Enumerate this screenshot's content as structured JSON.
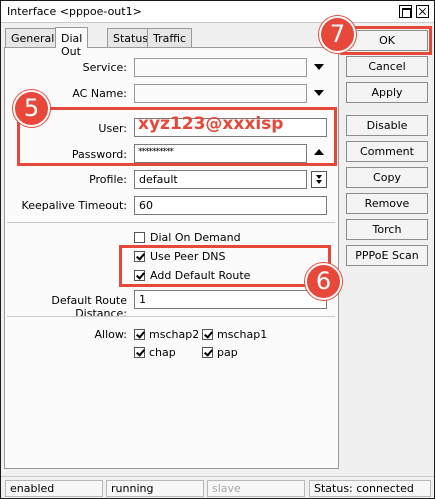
{
  "window": {
    "title": "Interface <pppoe-out1>"
  },
  "tabs": [
    "General",
    "Dial Out",
    "Status",
    "Traffic"
  ],
  "form": {
    "service_label": "Service:",
    "service_value": "",
    "ac_name_label": "AC Name:",
    "ac_name_value": "",
    "user_label": "User:",
    "user_value": "xyz123@xxxisp",
    "password_label": "Password:",
    "password_value": "**********",
    "profile_label": "Profile:",
    "profile_value": "default",
    "keepalive_label": "Keepalive Timeout:",
    "keepalive_value": "60",
    "dial_on_demand_label": "Dial On Demand",
    "dial_on_demand_checked": false,
    "use_peer_dns_label": "Use Peer DNS",
    "use_peer_dns_checked": true,
    "add_default_route_label": "Add Default Route",
    "add_default_route_checked": true,
    "default_route_distance_label": "Default Route Distance:",
    "default_route_distance_value": "1",
    "allow_label": "Allow:",
    "allow_options": [
      {
        "label": "mschap2",
        "checked": true
      },
      {
        "label": "mschap1",
        "checked": true
      },
      {
        "label": "chap",
        "checked": true
      },
      {
        "label": "pap",
        "checked": true
      }
    ]
  },
  "buttons": {
    "ok": "OK",
    "cancel": "Cancel",
    "apply": "Apply",
    "disable": "Disable",
    "comment": "Comment",
    "copy": "Copy",
    "remove": "Remove",
    "torch": "Torch",
    "pppoe_scan": "PPPoE Scan"
  },
  "annotations": {
    "badge_5": "5",
    "badge_6": "6",
    "badge_7": "7"
  },
  "status_bar": [
    "enabled",
    "running",
    "slave",
    "Status: connected"
  ],
  "colors": {
    "annotation_red": "#e8483a",
    "username_text": "#e8483a"
  }
}
